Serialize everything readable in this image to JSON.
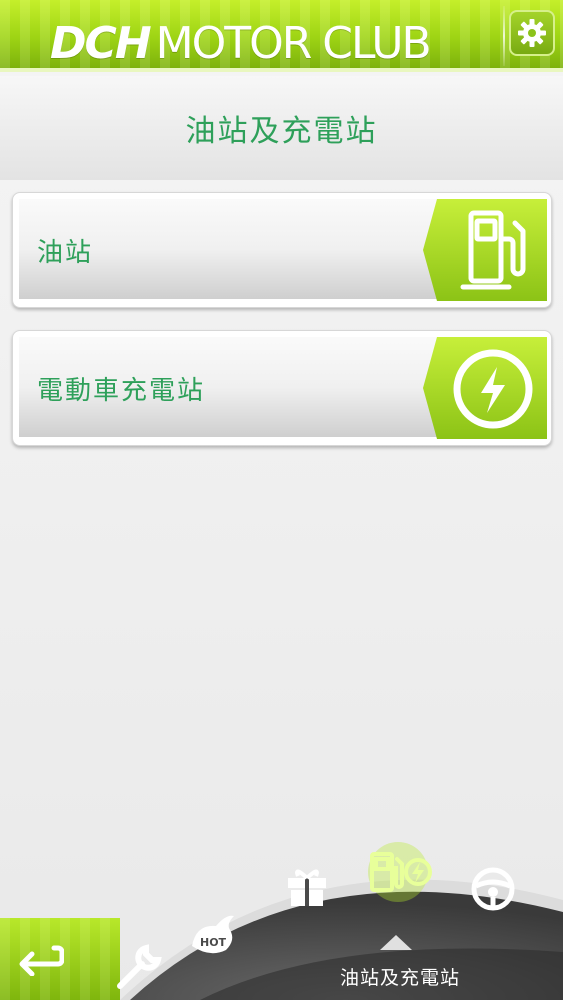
{
  "header": {
    "logo_bold": "DCH",
    "logo_thin": "MOTOR CLUB",
    "settings_icon": "gear-icon"
  },
  "page": {
    "title": "油站及充電站"
  },
  "menu": [
    {
      "label": "油站",
      "icon": "fuel-pump-icon"
    },
    {
      "label": "電動車充電站",
      "icon": "lightning-icon"
    }
  ],
  "bottom_nav": {
    "active_caption": "油站及充電站",
    "items": [
      {
        "icon": "wrench-icon"
      },
      {
        "icon": "hot-flame-icon",
        "text": "HOT"
      },
      {
        "icon": "gift-icon"
      },
      {
        "icon": "fuel-charge-icon"
      },
      {
        "icon": "steering-wheel-icon"
      }
    ],
    "back_icon": "back-arrow-icon"
  },
  "colors": {
    "brand_green": "#9ed414",
    "text_green": "#2ea05a",
    "wheel_dark": "#4a4a4a"
  }
}
